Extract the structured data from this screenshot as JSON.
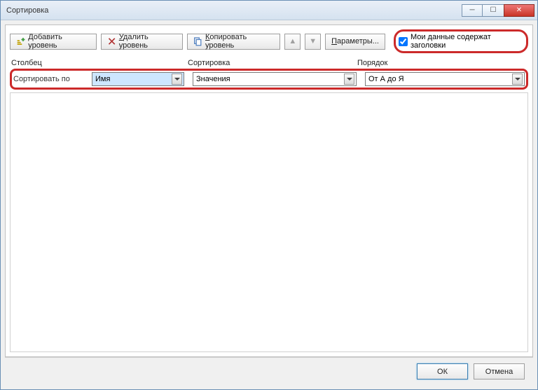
{
  "title": "Сортировка",
  "toolbar": {
    "add": "Добавить уровень",
    "delete": "Удалить уровень",
    "copy": "Копировать уровень",
    "options": "Параметры...",
    "headers_check": "Мои данные содержат заголовки"
  },
  "headers": {
    "col1": "Столбец",
    "col2": "Сортировка",
    "col3": "Порядок"
  },
  "row": {
    "label": "Сортировать по",
    "column_value": "Имя",
    "sort_value": "Значения",
    "order_value": "От А до Я"
  },
  "footer": {
    "ok": "ОК",
    "cancel": "Отмена"
  }
}
